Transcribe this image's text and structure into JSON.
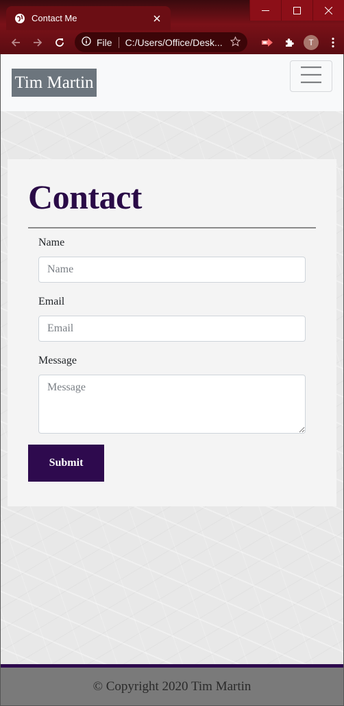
{
  "browser": {
    "tab_title": "Contact Me",
    "url_scheme": "File",
    "url": "C:/Users/Office/Desk...",
    "profile_initial": "T",
    "accent_color": "#8c0f18"
  },
  "navbar": {
    "brand": "Tim Martin"
  },
  "contact": {
    "heading": "Contact",
    "name_label": "Name",
    "name_placeholder": "Name",
    "email_label": "Email",
    "email_placeholder": "Email",
    "message_label": "Message",
    "message_placeholder": "Message",
    "submit_label": "Submit",
    "heading_color": "#2a0b47",
    "button_color": "#2e0a4e"
  },
  "footer": {
    "text": "© Copyright 2020 Tim Martin"
  },
  "icons": [
    "globe-icon",
    "close-icon",
    "minimize-icon",
    "maximize-icon",
    "back-icon",
    "forward-icon",
    "reload-icon",
    "info-icon",
    "star-icon",
    "extension-icon",
    "puzzle-icon",
    "menu-icon",
    "hamburger-icon"
  ]
}
